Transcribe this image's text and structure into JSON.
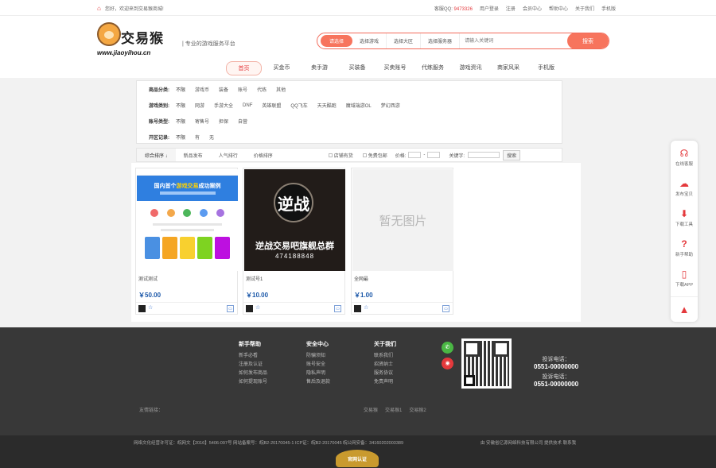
{
  "topbar": {
    "welcome": "您好，欢迎来到交易猴商城!",
    "qq_label": "客服QQ:",
    "qq_value": "9473326",
    "login": "用户登录",
    "register": "注册",
    "links": [
      "会员中心",
      "帮助中心",
      "关于我们",
      "手机版"
    ]
  },
  "header": {
    "brand": "交易猴",
    "url": "www.jiaoyihou.cn",
    "slogan": "| 专业的游戏服务平台",
    "search": {
      "types": [
        "请选择",
        "选择游戏",
        "选择大区",
        "选择服务器"
      ],
      "placeholder": "请输入关键词",
      "button": "搜索"
    }
  },
  "nav": [
    "首页",
    "买金币",
    "卖手游",
    "买装备",
    "买卖账号",
    "代练服务",
    "游戏资讯",
    "商家风采",
    "手机版"
  ],
  "filter": {
    "rows": [
      {
        "label": "商品分类:",
        "options": [
          "不限",
          "游戏币",
          "装备",
          "账号",
          "代练",
          "其他"
        ]
      },
      {
        "label": "游戏类别:",
        "options": [
          "不限",
          "网游",
          "手游大全",
          "DNF",
          "英雄联盟",
          "QQ飞车",
          "天天酷跑",
          "魔域端游OL",
          "梦幻西游"
        ]
      },
      {
        "label": "账号类型:",
        "options": [
          "不限",
          "寄售号",
          "担保",
          "自营"
        ]
      },
      {
        "label": "开区记录:",
        "options": [
          "不限",
          "有",
          "无"
        ]
      }
    ]
  },
  "sortbar": {
    "sorts": [
      "综合排序 ↓",
      "新品发布",
      "人气排行",
      "价格排序"
    ],
    "checks": [
      "店铺有货",
      "免费包邮"
    ],
    "price_label": "价格:",
    "keyword_label": "关键字:",
    "button": "搜索"
  },
  "products": [
    {
      "title": "测试测试",
      "price": "￥50.00",
      "banner_main": "国内首个",
      "banner_highlight": "游戏交易",
      "banner_tail": "成功案例"
    },
    {
      "title": "测试号1",
      "price": "￥10.00",
      "name": "逆战交易吧旗舰总群",
      "number": "474188848",
      "logo_text": "逆战"
    },
    {
      "title": "全网最",
      "price": "￥1.00",
      "noimg": "暂无图片"
    }
  ],
  "sidebar": [
    {
      "icon": "customer-service-icon",
      "label": "在线客服"
    },
    {
      "icon": "upload-icon",
      "label": "发布宝贝"
    },
    {
      "icon": "download-icon",
      "label": "下载工具"
    },
    {
      "icon": "help-icon",
      "label": "新手帮助"
    },
    {
      "icon": "phone-icon",
      "label": "下载APP"
    }
  ],
  "footer": {
    "columns": [
      {
        "title": "新手帮助",
        "links": [
          "新手必看",
          "注册及认证",
          "如何发布商品",
          "如何提现账号"
        ]
      },
      {
        "title": "安全中心",
        "links": [
          "防骗须知",
          "账号安全",
          "隐私声明",
          "售后及退款"
        ]
      },
      {
        "title": "关于我们",
        "links": [
          "联系我们",
          "招贤纳士",
          "服务协议",
          "免责声明"
        ]
      }
    ],
    "phone_labels": [
      "投诉电话：",
      "投诉电话："
    ],
    "phones": [
      "0551-00000000",
      "0551-00000000"
    ],
    "friend_links_label": "友情链接：",
    "friend_links": [
      "交易猴",
      "交易猴1",
      "交易猴2"
    ],
    "copyright": "网络文化经营许可证：皖网文【2016】5406-097号  网站备案号：皖B2-20170045-1  ICP证：皖B2-20170045  皖公网安备：34160202003389",
    "company": "由 安徽省亿源网络科技有限公司 提供技术  联系我",
    "badge": "官网认证"
  },
  "colors": {
    "accent": "#f7745d",
    "brand_red": "#e4393c",
    "price_blue": "#1a57a8"
  }
}
